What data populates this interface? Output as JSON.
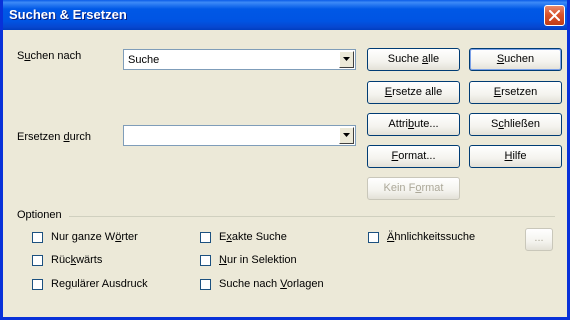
{
  "window": {
    "title": "Suchen & Ersetzen"
  },
  "search": {
    "label_pre": "S",
    "label_u": "u",
    "label_post": "chen nach",
    "value": "Suche"
  },
  "replace": {
    "label_pre": "Ersetzen ",
    "label_u": "d",
    "label_post": "urch",
    "value": ""
  },
  "buttons": {
    "search_all": {
      "pre": "Suche ",
      "u": "a",
      "post": "lle"
    },
    "search": {
      "pre": "",
      "u": "S",
      "post": "uchen"
    },
    "replace_all": {
      "pre": "",
      "u": "E",
      "post": "rsetze alle"
    },
    "replace": {
      "pre": "",
      "u": "E",
      "post": "rsetzen"
    },
    "attributes": {
      "pre": "Attri",
      "u": "b",
      "post": "ute..."
    },
    "close": {
      "pre": "S",
      "u": "c",
      "post": "hließen"
    },
    "format": {
      "pre": "",
      "u": "F",
      "post": "ormat..."
    },
    "help": {
      "pre": "",
      "u": "H",
      "post": "ilfe"
    },
    "no_format": {
      "pre": "Kein F",
      "u": "o",
      "post": "rmat"
    },
    "ellipsis": "..."
  },
  "options": {
    "label": "Optionen",
    "whole_words": {
      "pre": "Nur ganze W",
      "u": "ö",
      "post": "rter"
    },
    "backwards": {
      "pre": "Rüc",
      "u": "k",
      "post": "wärts"
    },
    "regex": {
      "pre": "Re",
      "u": "g",
      "post": "ulärer Ausdruck"
    },
    "exact": {
      "pre": "E",
      "u": "x",
      "post": "akte Suche"
    },
    "selection": {
      "pre": "",
      "u": "N",
      "post": "ur in Selektion"
    },
    "templates": {
      "pre": "Suche nach ",
      "u": "V",
      "post": "orlagen"
    },
    "similarity": {
      "pre": "",
      "u": "Ä",
      "post": "hnlichkeitssuche"
    }
  },
  "colors": {
    "title_bar": "#0054e3",
    "close_button": "#d9532c",
    "dialog_bg": "#ece9d8",
    "disabled_text": "#aca899"
  }
}
